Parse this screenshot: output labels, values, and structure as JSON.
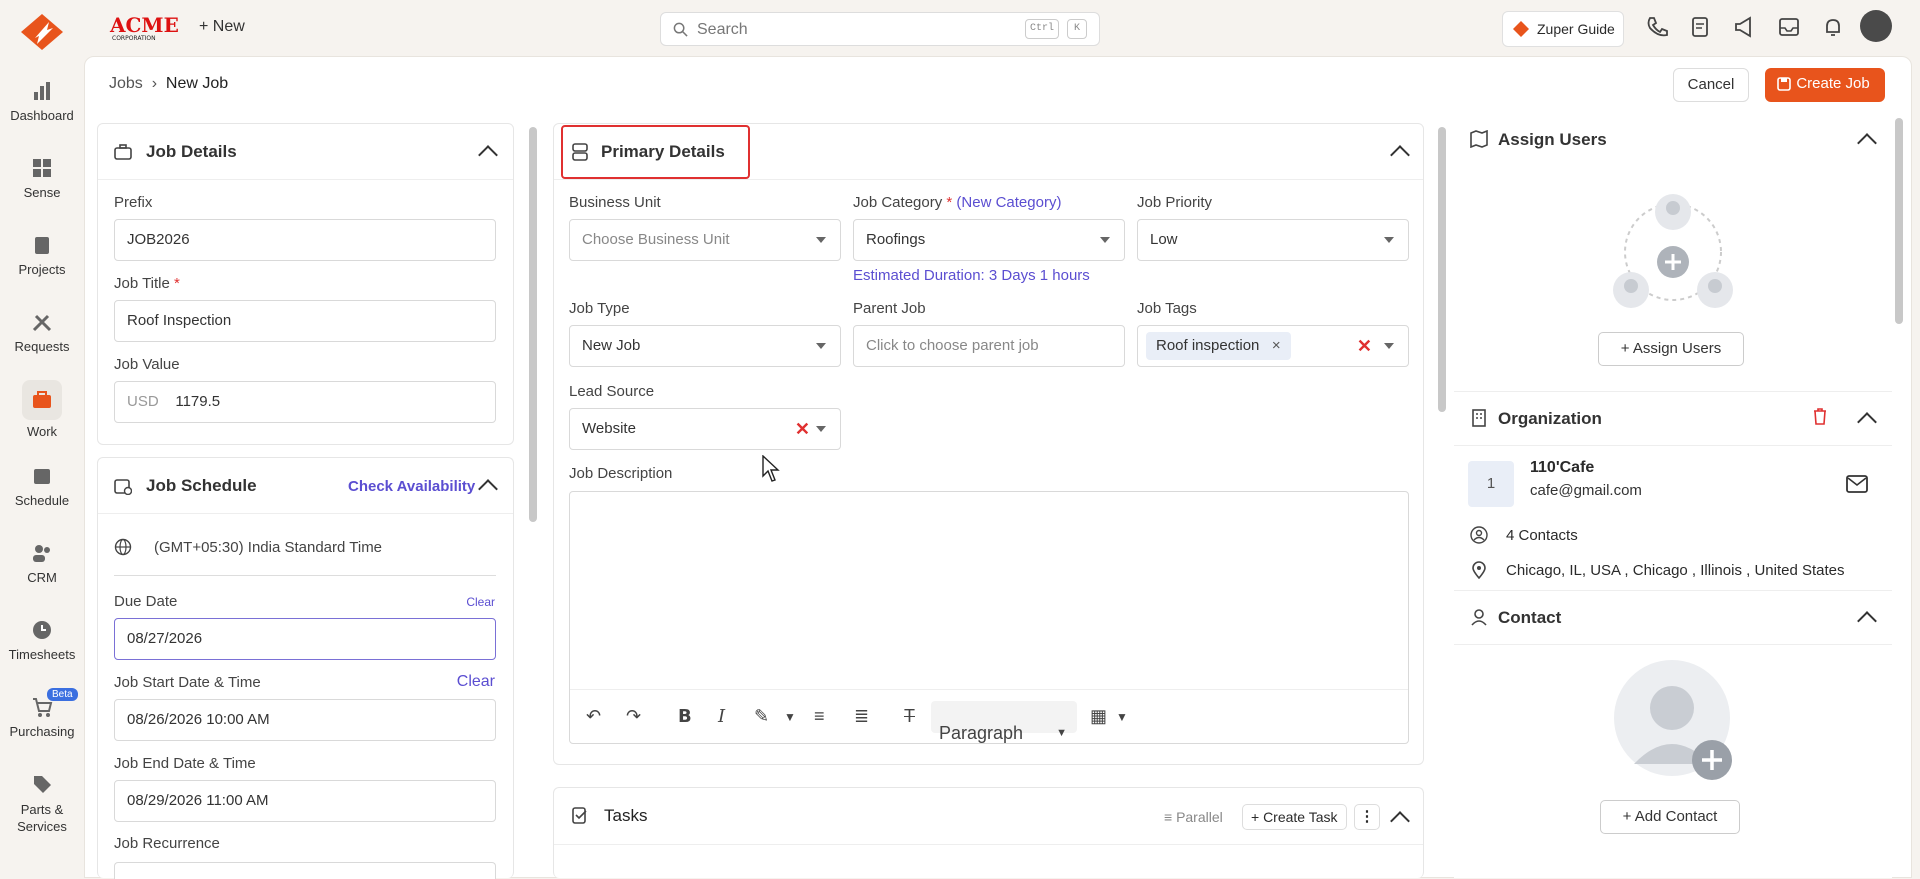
{
  "sidebar": {
    "items": [
      {
        "label": "Dashboard"
      },
      {
        "label": "Sense"
      },
      {
        "label": "Projects"
      },
      {
        "label": "Requests"
      },
      {
        "label": "Work"
      },
      {
        "label": "Schedule"
      },
      {
        "label": "CRM"
      },
      {
        "label": "Timesheets"
      },
      {
        "label": "Purchasing",
        "badge": "Beta"
      },
      {
        "label": "Parts &",
        "label2": "Services"
      }
    ]
  },
  "topbar": {
    "new_label": "+ New",
    "search_placeholder": "Search",
    "key1": "Ctrl",
    "key2": "K",
    "guide_label": "Zuper Guide"
  },
  "header": {
    "crumb_parent": "Jobs",
    "crumb_current": "New Job",
    "cancel_label": "Cancel",
    "create_label": "Create Job"
  },
  "job_details": {
    "title": "Job Details",
    "prefix_label": "Prefix",
    "prefix_value": "JOB2026",
    "title_label": "Job Title",
    "title_value": "Roof Inspection",
    "value_label": "Job Value",
    "currency": "USD",
    "value": "1179.5"
  },
  "job_schedule": {
    "title": "Job Schedule",
    "check_label": "Check Availability",
    "timezone": "(GMT+05:30) India Standard Time",
    "due_label": "Due Date",
    "clear1": "Clear",
    "due_value": "08/27/2026",
    "start_label": "Job Start Date & Time",
    "clear2": "Clear",
    "start_value": "08/26/2026 10:00 AM",
    "end_label": "Job End Date & Time",
    "end_value": "08/29/2026 11:00 AM",
    "recurrence_label": "Job Recurrence"
  },
  "primary": {
    "title": "Primary Details",
    "bu_label": "Business Unit",
    "bu_placeholder": "Choose Business Unit",
    "cat_label": "Job Category",
    "cat_link": "(New Category)",
    "cat_value": "Roofings",
    "duration": "Estimated Duration: 3 Days 1 hours",
    "priority_label": "Job Priority",
    "priority_value": "Low",
    "type_label": "Job Type",
    "type_value": "New Job",
    "parent_label": "Parent Job",
    "parent_placeholder": "Click to choose parent job",
    "tags_label": "Job Tags",
    "tag1": "Roof inspection",
    "lead_label": "Lead Source",
    "lead_value": "Website",
    "desc_label": "Job Description",
    "format_value": "Paragraph"
  },
  "tasks": {
    "title": "Tasks",
    "parallel_label": "Parallel",
    "create_task_label": "+ Create Task"
  },
  "assign": {
    "title": "Assign Users",
    "button": "+ Assign Users"
  },
  "org": {
    "title": "Organization",
    "badge": "1",
    "name": "110'Cafe",
    "email": "cafe@gmail.com",
    "contacts": "4 Contacts",
    "address": "Chicago, IL, USA , Chicago , Illinois , United States"
  },
  "contact": {
    "title": "Contact",
    "button": "+ Add Contact"
  },
  "colors": {
    "accent": "#e8541c",
    "link": "#5b4ed1",
    "highlight": "#e03030"
  }
}
